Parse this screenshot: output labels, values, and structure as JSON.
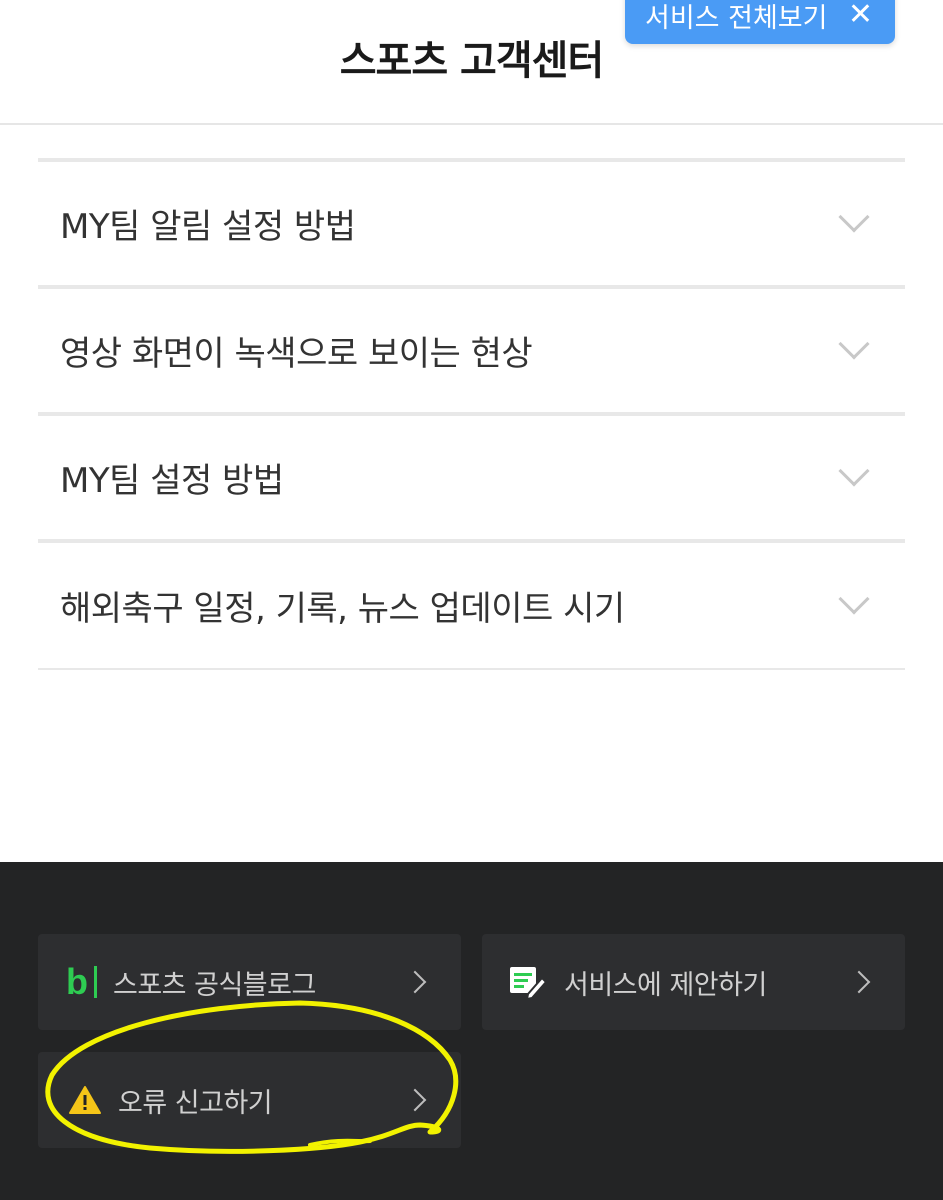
{
  "header": {
    "title": "스포츠 고객센터",
    "service_all_label": "서비스 전체보기",
    "close_symbol": "✕"
  },
  "faq": {
    "items": [
      {
        "label": "MY팀 알림 설정 방법"
      },
      {
        "label": "영상 화면이 녹색으로 보이는 현상"
      },
      {
        "label": "MY팀 설정 방법"
      },
      {
        "label": "해외축구 일정, 기록, 뉴스 업데이트 시기"
      }
    ]
  },
  "footer": {
    "blog": {
      "icon": "b",
      "label": "스포츠 공식블로그"
    },
    "suggest": {
      "label": "서비스에 제안하기"
    },
    "report": {
      "label": "오류 신고하기"
    }
  },
  "colors": {
    "accent_button": "#4a9bf5",
    "footer_bg": "#232425",
    "blog_green": "#2ecc52",
    "warning_yellow": "#f5c518",
    "annotation_yellow": "#f2f200"
  }
}
